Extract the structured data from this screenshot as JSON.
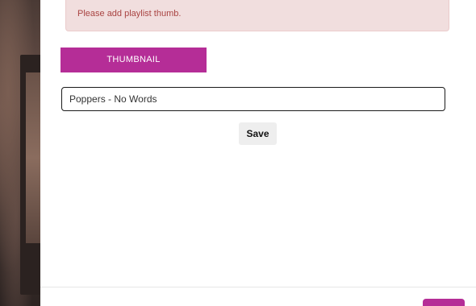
{
  "alert": {
    "message": "Please add playlist thumb."
  },
  "form": {
    "thumbnail_button_label": "THUMBNAIL",
    "name_value": "Poppers - No Words",
    "save_label": "Save"
  },
  "colors": {
    "accent": "#b52d97",
    "alert_background": "#f1dede",
    "alert_text": "#a94442"
  }
}
